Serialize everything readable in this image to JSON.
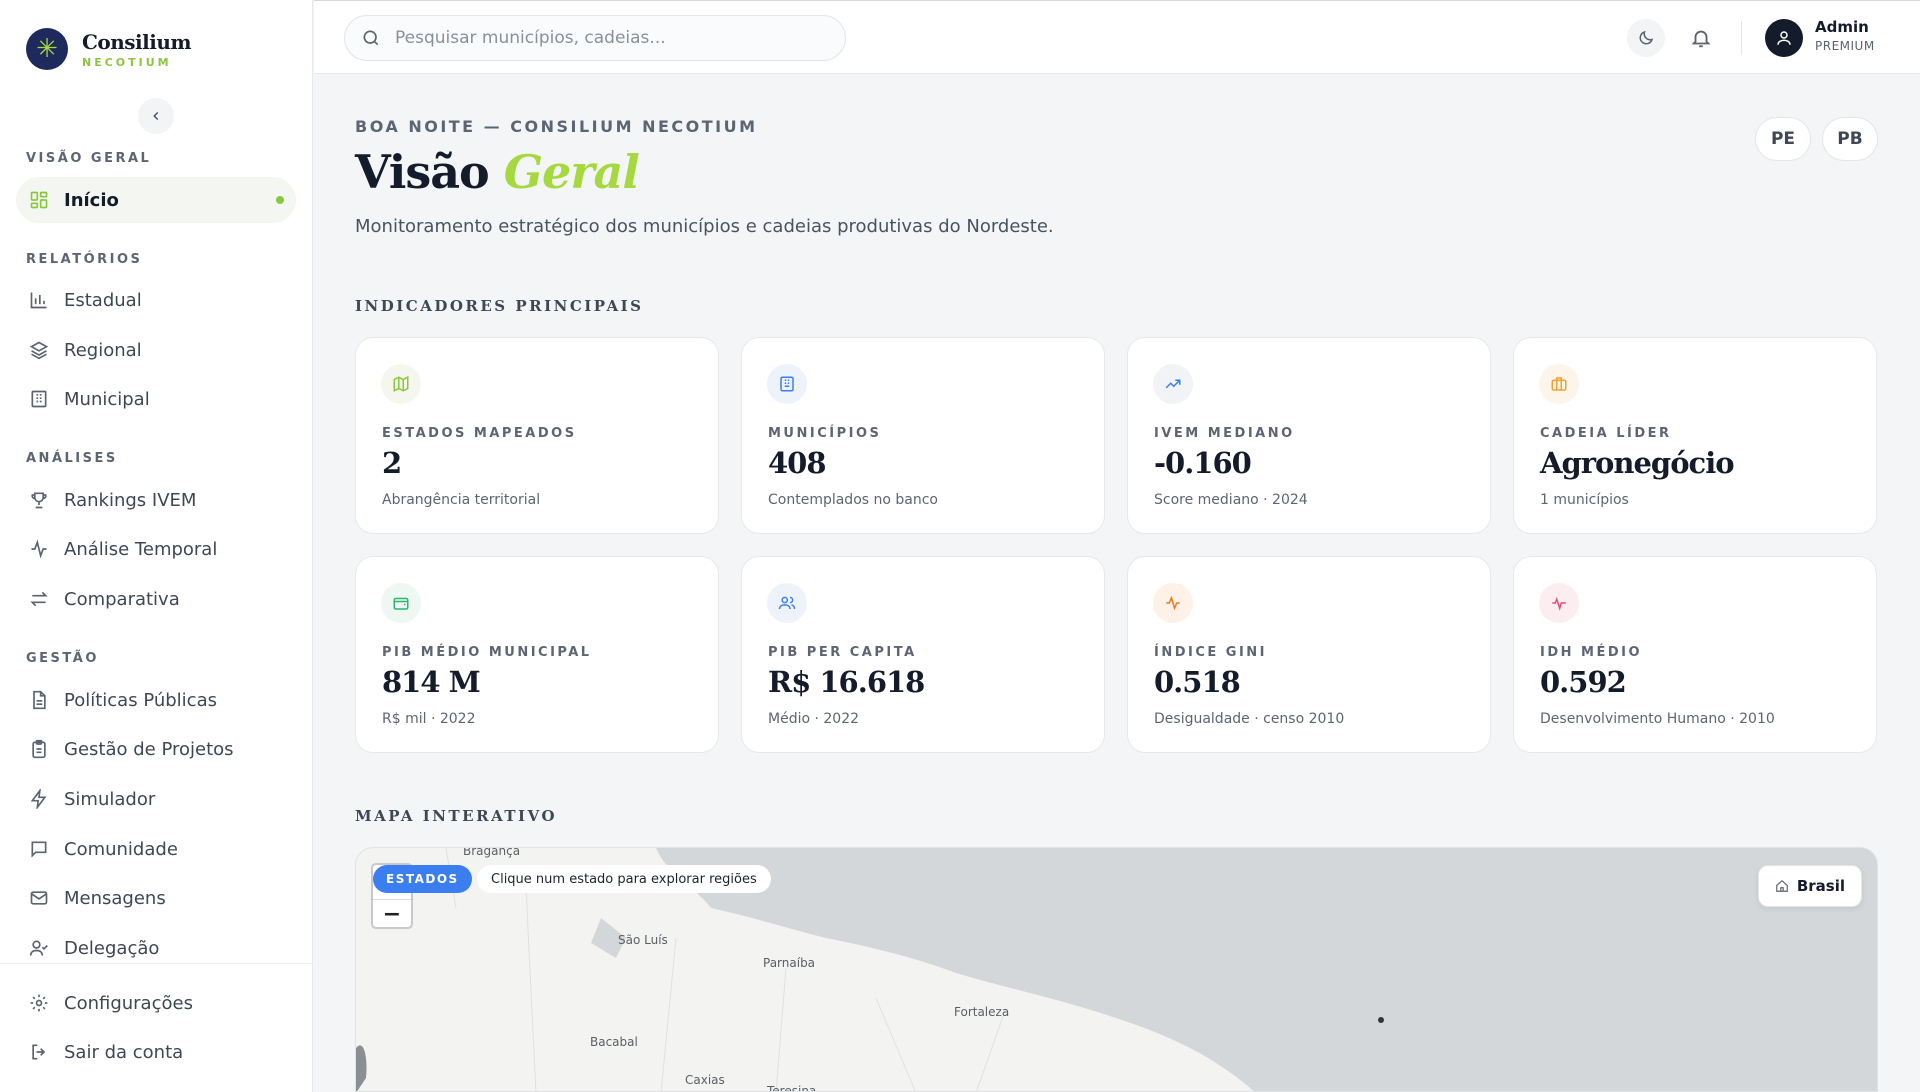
{
  "brand": {
    "name": "Consilium",
    "sub": "NECOTIUM"
  },
  "sidebar": {
    "sections": [
      {
        "title": "VISÃO GERAL"
      },
      {
        "title": "RELATÓRIOS"
      },
      {
        "title": "ANÁLISES"
      },
      {
        "title": "GESTÃO"
      }
    ],
    "items": [
      {
        "label": "Início",
        "icon": "grid-icon",
        "active": true
      },
      {
        "label": "Estadual",
        "icon": "bar-chart-icon"
      },
      {
        "label": "Regional",
        "icon": "layers-icon"
      },
      {
        "label": "Municipal",
        "icon": "building-icon"
      },
      {
        "label": "Rankings IVEM",
        "icon": "trophy-icon"
      },
      {
        "label": "Análise Temporal",
        "icon": "activity-icon"
      },
      {
        "label": "Comparativa",
        "icon": "arrows-icon"
      },
      {
        "label": "Políticas Públicas",
        "icon": "document-icon"
      },
      {
        "label": "Gestão de Projetos",
        "icon": "clipboard-icon"
      },
      {
        "label": "Simulador",
        "icon": "bolt-icon"
      },
      {
        "label": "Comunidade",
        "icon": "chat-icon"
      },
      {
        "label": "Mensagens",
        "icon": "mail-icon"
      },
      {
        "label": "Delegação",
        "icon": "user-check-icon"
      }
    ],
    "footer": [
      {
        "label": "Configurações",
        "icon": "gear-icon"
      },
      {
        "label": "Sair da conta",
        "icon": "logout-icon"
      }
    ]
  },
  "topbar": {
    "search_placeholder": "Pesquisar municípios, cadeias...",
    "user": {
      "name": "Admin",
      "plan": "PREMIUM"
    }
  },
  "main": {
    "greeting": "BOA NOITE — CONSILIUM NECOTIUM",
    "title": "Visão",
    "title_accent": "Geral",
    "subtitle": "Monitoramento estratégico dos municípios e cadeias produtivas do Nordeste.",
    "state_chips": [
      "PE",
      "PB"
    ],
    "indicators_title": "INDICADORES PRINCIPAIS",
    "map_title": "MAPA INTERATIVO"
  },
  "cards": [
    {
      "label": "ESTADOS MAPEADOS",
      "value": "2",
      "note": "Abrangência territorial",
      "icon": "map-icon",
      "color": "#8cc63f",
      "bg": "#f5f7ef"
    },
    {
      "label": "MUNICÍPIOS",
      "value": "408",
      "note": "Contemplados no banco",
      "icon": "building-icon",
      "color": "#3b7ef0",
      "bg": "#eef3fb"
    },
    {
      "label": "IVEM MEDIANO",
      "value": "-0.160",
      "note": "Score mediano · 2024",
      "icon": "trend-up-icon",
      "color": "#3b7ef0",
      "bg": "#f1f3f6"
    },
    {
      "label": "CADEIA LÍDER",
      "value": "Agronegócio",
      "note": "1 municípios",
      "icon": "briefcase-icon",
      "color": "#f0a030",
      "bg": "#fdf4ea"
    },
    {
      "label": "PIB MÉDIO MUNICIPAL",
      "value": "814 M",
      "note": "R$ mil · 2022",
      "icon": "wallet-icon",
      "color": "#2bb673",
      "bg": "#eef7f1"
    },
    {
      "label": "PIB PER CAPITA",
      "value": "R$ 16.618",
      "note": "Médio · 2022",
      "icon": "users-icon",
      "color": "#3b7ef0",
      "bg": "#eef3fb"
    },
    {
      "label": "ÍNDICE GINI",
      "value": "0.518",
      "note": "Desigualdade · censo 2010",
      "icon": "pulse-icon",
      "color": "#f07a20",
      "bg": "#fdf1e8"
    },
    {
      "label": "IDH MÉDIO",
      "value": "0.592",
      "note": "Desenvolvimento Humano · 2010",
      "icon": "heartbeat-icon",
      "color": "#e84a7a",
      "bg": "#fcedf1"
    }
  ],
  "map": {
    "badge": "ESTADOS",
    "hint": "Clique num estado para explorar regiões",
    "zoom_out": "−",
    "country_button": "Brasil",
    "cities": [
      "Bragança",
      "São Luís",
      "Parnaíba",
      "Fortaleza",
      "Bacabal",
      "Caxias",
      "Teresina"
    ]
  }
}
